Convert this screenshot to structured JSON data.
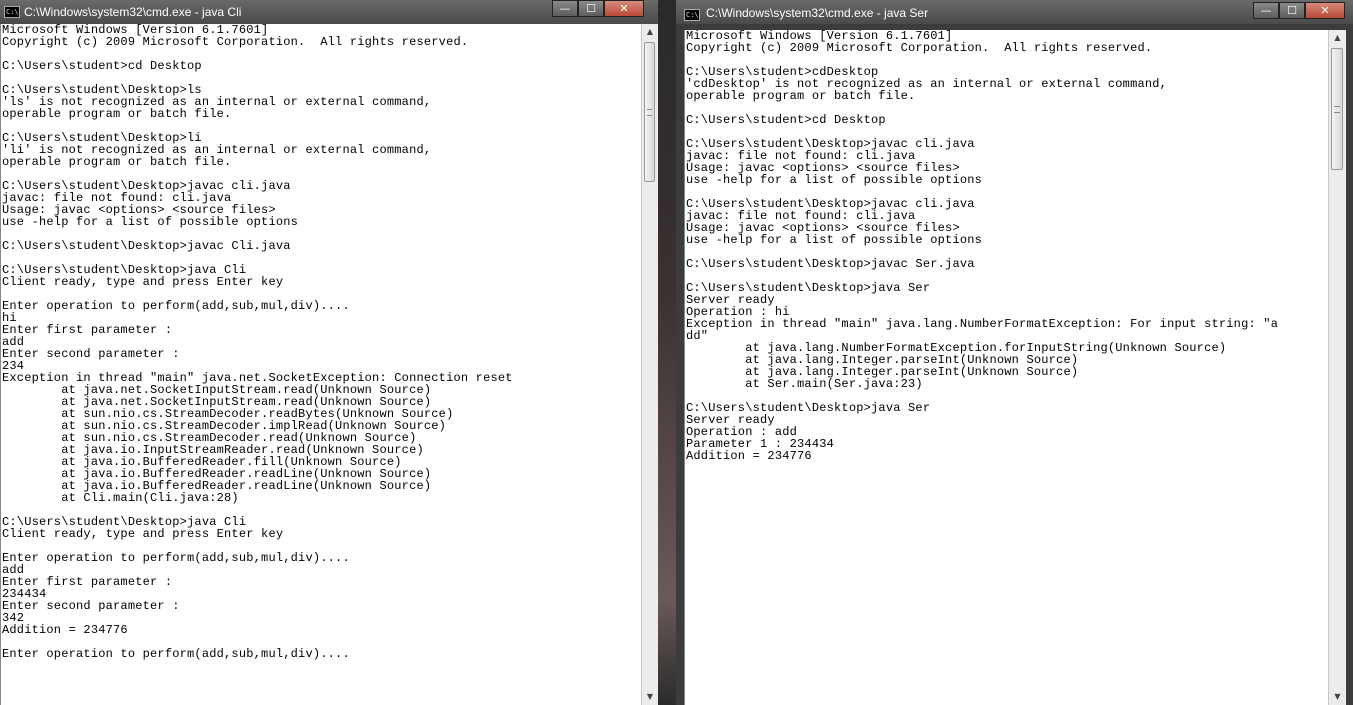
{
  "left_window": {
    "title": "C:\\Windows\\system32\\cmd.exe - java  Cli",
    "controls": {
      "minimize": "—",
      "maximize": "☐",
      "close": "✕"
    },
    "lines": [
      "Microsoft Windows [Version 6.1.7601]",
      "Copyright (c) 2009 Microsoft Corporation.  All rights reserved.",
      "",
      "C:\\Users\\student>cd Desktop",
      "",
      "C:\\Users\\student\\Desktop>ls",
      "'ls' is not recognized as an internal or external command,",
      "operable program or batch file.",
      "",
      "C:\\Users\\student\\Desktop>li",
      "'li' is not recognized as an internal or external command,",
      "operable program or batch file.",
      "",
      "C:\\Users\\student\\Desktop>javac cli.java",
      "javac: file not found: cli.java",
      "Usage: javac <options> <source files>",
      "use -help for a list of possible options",
      "",
      "C:\\Users\\student\\Desktop>javac Cli.java",
      "",
      "C:\\Users\\student\\Desktop>java Cli",
      "Client ready, type and press Enter key",
      "",
      "Enter operation to perform(add,sub,mul,div)....",
      "hi",
      "Enter first parameter :",
      "add",
      "Enter second parameter :",
      "234",
      "Exception in thread \"main\" java.net.SocketException: Connection reset",
      "        at java.net.SocketInputStream.read(Unknown Source)",
      "        at java.net.SocketInputStream.read(Unknown Source)",
      "        at sun.nio.cs.StreamDecoder.readBytes(Unknown Source)",
      "        at sun.nio.cs.StreamDecoder.implRead(Unknown Source)",
      "        at sun.nio.cs.StreamDecoder.read(Unknown Source)",
      "        at java.io.InputStreamReader.read(Unknown Source)",
      "        at java.io.BufferedReader.fill(Unknown Source)",
      "        at java.io.BufferedReader.readLine(Unknown Source)",
      "        at java.io.BufferedReader.readLine(Unknown Source)",
      "        at Cli.main(Cli.java:28)",
      "",
      "C:\\Users\\student\\Desktop>java Cli",
      "Client ready, type and press Enter key",
      "",
      "Enter operation to perform(add,sub,mul,div)....",
      "add",
      "Enter first parameter :",
      "234434",
      "Enter second parameter :",
      "342",
      "Addition = 234776",
      "",
      "Enter operation to perform(add,sub,mul,div)...."
    ]
  },
  "right_window": {
    "title": "C:\\Windows\\system32\\cmd.exe - java  Ser",
    "controls": {
      "minimize": "—",
      "maximize": "☐",
      "close": "✕"
    },
    "lines": [
      "Microsoft Windows [Version 6.1.7601]",
      "Copyright (c) 2009 Microsoft Corporation.  All rights reserved.",
      "",
      "C:\\Users\\student>cdDesktop",
      "'cdDesktop' is not recognized as an internal or external command,",
      "operable program or batch file.",
      "",
      "C:\\Users\\student>cd Desktop",
      "",
      "C:\\Users\\student\\Desktop>javac cli.java",
      "javac: file not found: cli.java",
      "Usage: javac <options> <source files>",
      "use -help for a list of possible options",
      "",
      "C:\\Users\\student\\Desktop>javac cli.java",
      "javac: file not found: cli.java",
      "Usage: javac <options> <source files>",
      "use -help for a list of possible options",
      "",
      "C:\\Users\\student\\Desktop>javac Ser.java",
      "",
      "C:\\Users\\student\\Desktop>java Ser",
      "Server ready",
      "Operation : hi",
      "Exception in thread \"main\" java.lang.NumberFormatException: For input string: \"a",
      "dd\"",
      "        at java.lang.NumberFormatException.forInputString(Unknown Source)",
      "        at java.lang.Integer.parseInt(Unknown Source)",
      "        at java.lang.Integer.parseInt(Unknown Source)",
      "        at Ser.main(Ser.java:23)",
      "",
      "C:\\Users\\student\\Desktop>java Ser",
      "Server ready",
      "Operation : add",
      "Parameter 1 : 234434",
      "Addition = 234776"
    ]
  },
  "scrollbar": {
    "up_arrow": "▲",
    "down_arrow": "▼"
  }
}
